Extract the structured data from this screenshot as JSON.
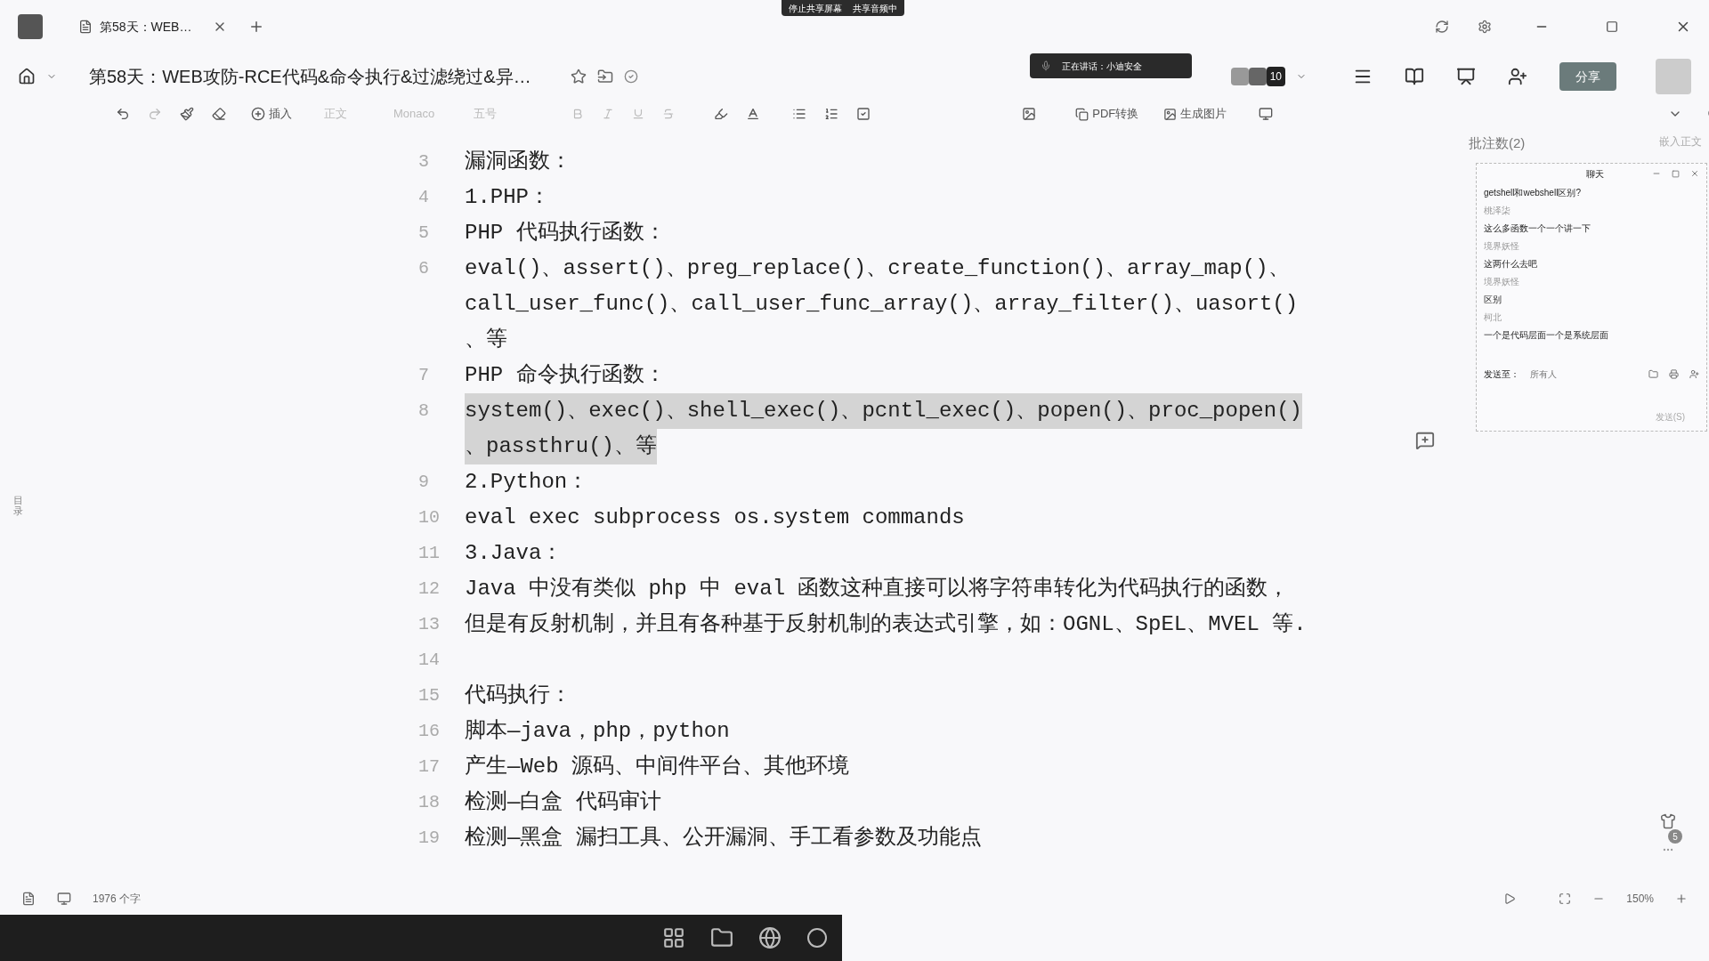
{
  "tab": {
    "title": "第58天：WEB…"
  },
  "share_banner": {
    "stop": "停止共享屏幕",
    "audio": "共享音频中"
  },
  "document": {
    "title": "第58天：WEB攻防-RCE代码&命令执行&过滤绕过&异…"
  },
  "speaking": {
    "text": "正在讲话：小迪安全"
  },
  "participants": {
    "count": "10"
  },
  "share_button": "分享",
  "toolbar": {
    "insert": "插入",
    "style": "正文",
    "font": "Monaco",
    "size": "五号",
    "pdf": "PDF转换",
    "image": "生成图片"
  },
  "sidebar": {
    "toc": "目录"
  },
  "lines": [
    {
      "number": "3",
      "rows": [
        "漏洞函数："
      ],
      "selected": false
    },
    {
      "number": "4",
      "rows": [
        "1.PHP："
      ],
      "selected": false
    },
    {
      "number": "5",
      "rows": [
        "PHP 代码执行函数："
      ],
      "selected": false
    },
    {
      "number": "6",
      "rows": [
        "eval()、assert()、preg_replace()、create_function()、array_map()、",
        "call_user_func()、call_user_func_array()、array_filter()、uasort()",
        "、等"
      ],
      "selected": false
    },
    {
      "number": "7",
      "rows": [
        "PHP 命令执行函数："
      ],
      "selected": false
    },
    {
      "number": "8",
      "rows": [
        "system()、exec()、shell_exec()、pcntl_exec()、popen()、proc_popen()",
        "、passthru()、等"
      ],
      "selected": true
    },
    {
      "number": "9",
      "rows": [
        "2.Python："
      ],
      "selected": false
    },
    {
      "number": "10",
      "rows": [
        "eval exec subprocess os.system commands"
      ],
      "selected": false
    },
    {
      "number": "11",
      "rows": [
        "3.Java："
      ],
      "selected": false
    },
    {
      "number": "12",
      "rows": [
        "Java 中没有类似 php 中 eval 函数这种直接可以将字符串转化为代码执行的函数，"
      ],
      "selected": false
    },
    {
      "number": "13",
      "rows": [
        "但是有反射机制，并且有各种基于反射机制的表达式引擎，如：OGNL、SpEL、MVEL 等."
      ],
      "selected": false
    },
    {
      "number": "14"
    },
    {
      "number": "15",
      "rows": [
        "代码执行："
      ],
      "selected": false
    },
    {
      "number": "16",
      "rows": [
        "脚本—java，php，python"
      ],
      "selected": false
    },
    {
      "number": "17",
      "rows": [
        "产生—Web 源码、中间件平台、其他环境"
      ],
      "selected": false
    },
    {
      "number": "18",
      "rows": [
        "检测—白盒  代码审计"
      ],
      "selected": false
    },
    {
      "number": "19",
      "rows": [
        "检测—黑盒  漏扫工具、公开漏洞、手工看参数及功能点"
      ],
      "selected": false
    }
  ],
  "comments": {
    "count_label": "批注数(2)",
    "embed": "嵌入正文"
  },
  "chat": {
    "title": "聊天",
    "messages": [
      {
        "kind": "message",
        "text": "getshell和webshell区别?"
      },
      {
        "kind": "name",
        "text": "桃泽柒"
      },
      {
        "kind": "message",
        "text": "这么多函数一个一个讲一下"
      },
      {
        "kind": "name",
        "text": "境界妖怪"
      },
      {
        "kind": "message",
        "text": "这两什么去吧"
      },
      {
        "kind": "name",
        "text": "境界妖怪"
      },
      {
        "kind": "message",
        "text": "区别"
      },
      {
        "kind": "name",
        "text": "柯北"
      },
      {
        "kind": "message",
        "text": "一个是代码层面一个是系统层面"
      }
    ],
    "send_to_label": "发送至：",
    "recipient": "所有人",
    "send": "发送(S)"
  },
  "badge": "5",
  "status_bar": {
    "word_count": "1976 个字",
    "zoom": "150%"
  }
}
